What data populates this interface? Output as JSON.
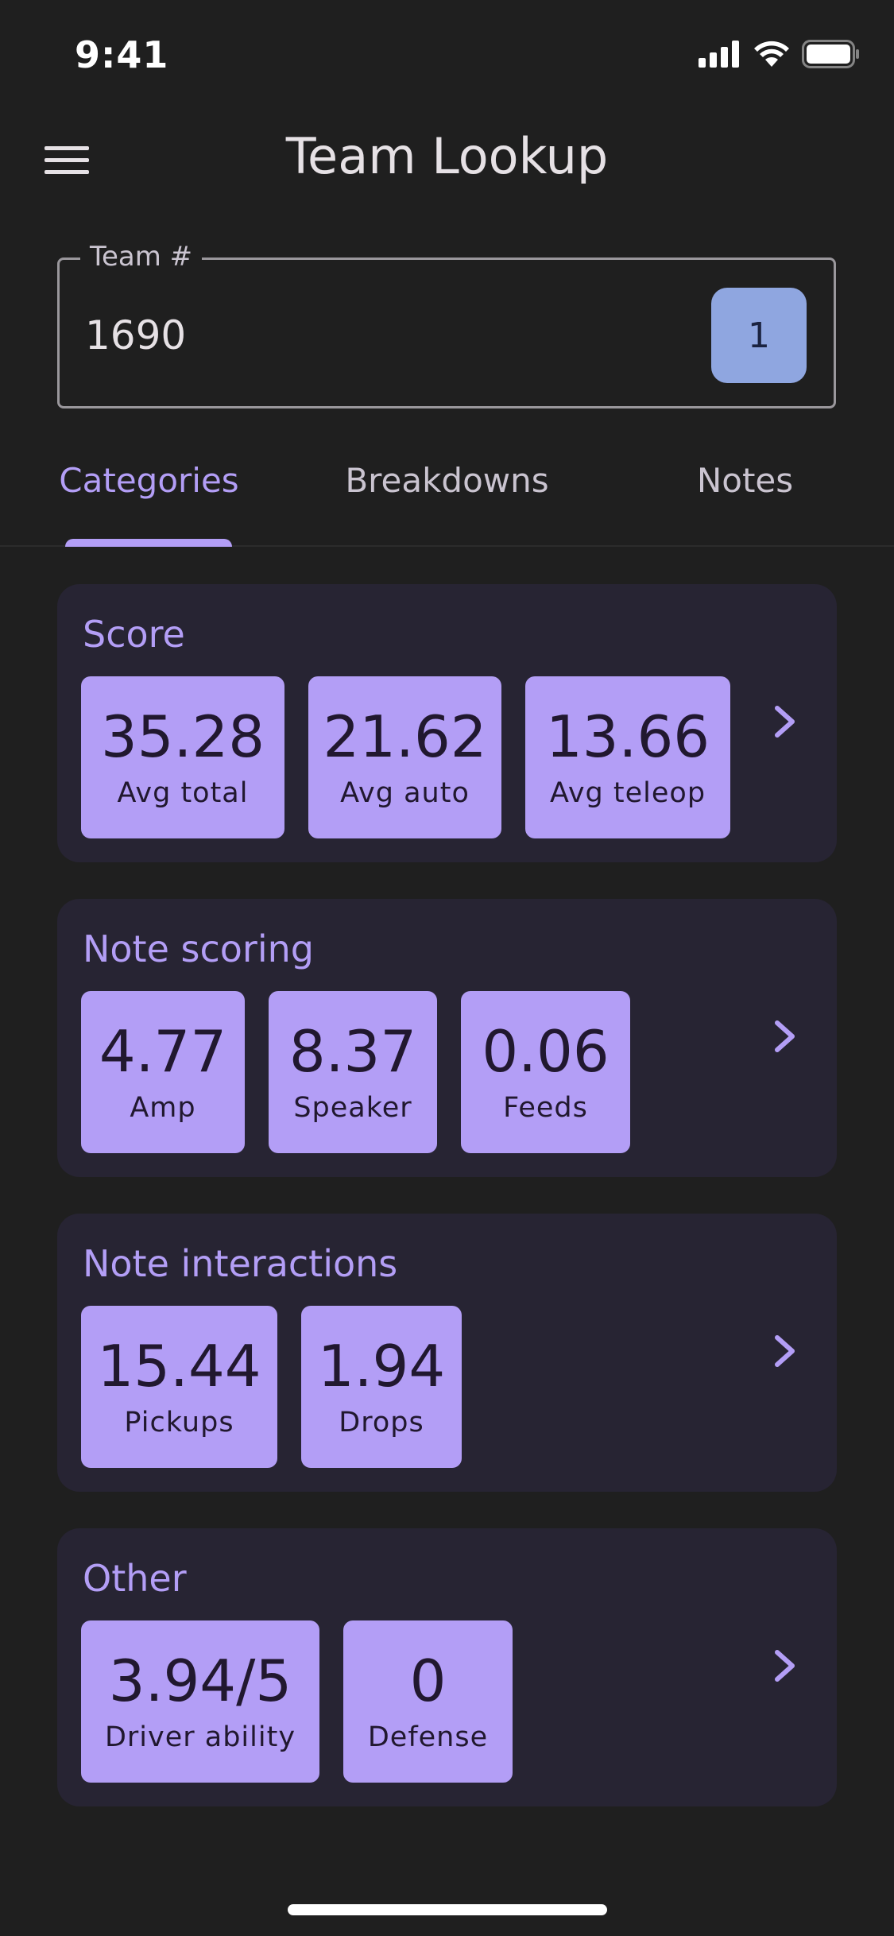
{
  "status_bar": {
    "time": "9:41"
  },
  "app_bar": {
    "title": "Team Lookup",
    "menu_icon": "hamburger-menu-icon"
  },
  "team_field": {
    "label": "Team #",
    "value": "1690",
    "badge": "1"
  },
  "tabs": [
    {
      "label": "Categories",
      "active": true
    },
    {
      "label": "Breakdowns",
      "active": false
    },
    {
      "label": "Notes",
      "active": false
    }
  ],
  "categories": [
    {
      "title": "Score",
      "stats": [
        {
          "value": "35.28",
          "label": "Avg total"
        },
        {
          "value": "21.62",
          "label": "Avg auto"
        },
        {
          "value": "13.66",
          "label": "Avg teleop"
        }
      ]
    },
    {
      "title": "Note scoring",
      "stats": [
        {
          "value": "4.77",
          "label": "Amp"
        },
        {
          "value": "8.37",
          "label": "Speaker"
        },
        {
          "value": "0.06",
          "label": "Feeds"
        }
      ]
    },
    {
      "title": "Note interactions",
      "stats": [
        {
          "value": "15.44",
          "label": "Pickups"
        },
        {
          "value": "1.94",
          "label": "Drops"
        }
      ]
    },
    {
      "title": "Other",
      "stats": [
        {
          "value": "3.94/5",
          "label": "Driver ability"
        },
        {
          "value": "0",
          "label": "Defense"
        }
      ]
    }
  ],
  "colors": {
    "background": "#1f1f1f",
    "accent": "#b39ef6",
    "card": "#272433",
    "badge": "#8fa6e0"
  }
}
